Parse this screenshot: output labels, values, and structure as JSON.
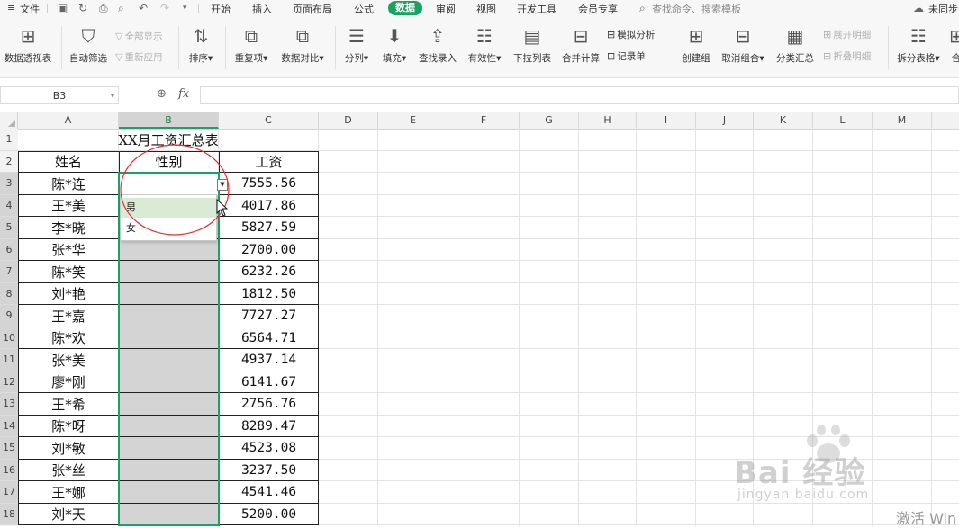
{
  "menubar": {
    "file": "文件",
    "tabs": [
      "开始",
      "插入",
      "页面布局",
      "公式",
      "数据",
      "审阅",
      "视图",
      "开发工具",
      "会员专享"
    ],
    "active_tab": "数据",
    "search_placeholder": "查找命令、搜索模板",
    "sync_status": "未同步",
    "accent_color": "#1aa260"
  },
  "ribbon": {
    "pivot": "数据透视表",
    "autofilter": "自动筛选",
    "show_all": "全部显示",
    "reapply": "重新应用",
    "sort": "排序",
    "duplicates": "重复项",
    "compare": "数据对比",
    "split": "分列",
    "fill": "填充",
    "find_entry": "查找录入",
    "validity": "有效性",
    "dropdown_list": "下拉列表",
    "consolidate": "合并计算",
    "simulation": "模拟分析",
    "record_sheet": "记录单",
    "group": "创建组",
    "ungroup": "取消组合",
    "subtotal": "分类汇总",
    "expand_detail": "展开明细",
    "collapse_detail": "折叠明细",
    "split_table": "拆分表格",
    "more": "合"
  },
  "formula_bar": {
    "name_box": "B3",
    "fx": "fx",
    "formula": ""
  },
  "columns": [
    "A",
    "B",
    "C",
    "D",
    "E",
    "F",
    "G",
    "H",
    "I",
    "J",
    "K",
    "L",
    "M"
  ],
  "rows": [
    "1",
    "2",
    "3",
    "4",
    "5",
    "6",
    "7",
    "8",
    "9",
    "10",
    "11",
    "12",
    "13",
    "14",
    "15",
    "16",
    "17",
    "18"
  ],
  "sheet": {
    "title": "XX月工资汇总表",
    "headers": [
      "姓名",
      "性别",
      "工资"
    ],
    "data": [
      [
        "陈*连",
        "7555.56"
      ],
      [
        "王*美",
        "4017.86"
      ],
      [
        "李*晓",
        "5827.59"
      ],
      [
        "张*华",
        "2700.00"
      ],
      [
        "陈*笑",
        "6232.26"
      ],
      [
        "刘*艳",
        "1812.50"
      ],
      [
        "王*嘉",
        "7727.27"
      ],
      [
        "陈*欢",
        "6564.71"
      ],
      [
        "张*美",
        "4937.14"
      ],
      [
        "廖*刚",
        "6141.67"
      ],
      [
        "王*希",
        "2756.76"
      ],
      [
        "陈*呀",
        "8289.47"
      ],
      [
        "刘*敏",
        "4523.08"
      ],
      [
        "张*丝",
        "3237.50"
      ],
      [
        "王*娜",
        "4541.46"
      ],
      [
        "刘*天",
        "5200.00"
      ]
    ]
  },
  "dropdown": {
    "options": [
      "男",
      "女"
    ],
    "hovered": "男"
  },
  "watermark": {
    "brand": "Bai 经验",
    "url": "jingyan.baidu.com"
  },
  "activation_text": "激活 Win"
}
